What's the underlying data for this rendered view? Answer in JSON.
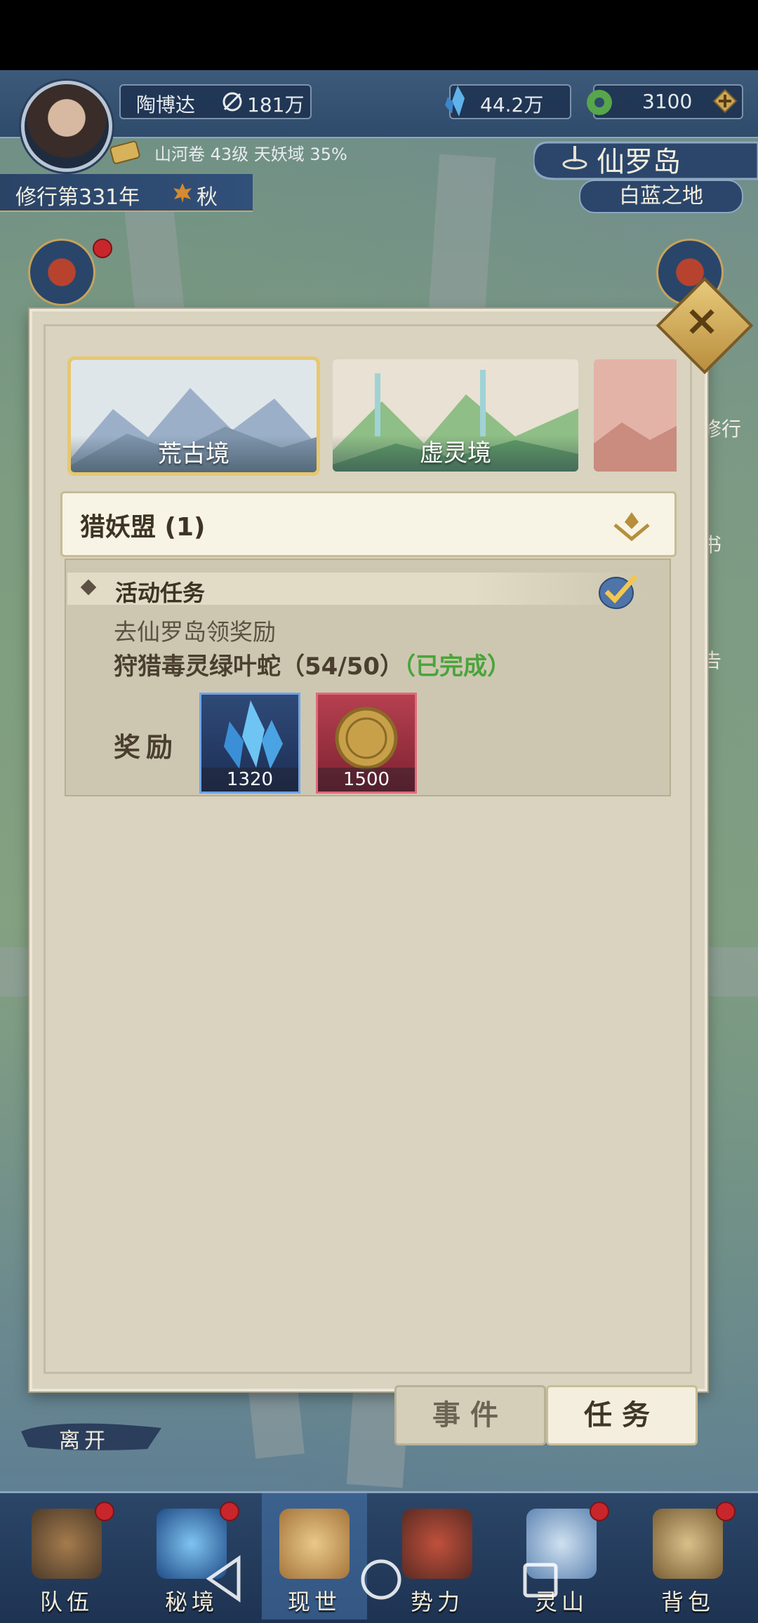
{
  "hud": {
    "player_name": "陶博达",
    "power": "181万",
    "crystal": "44.2万",
    "jade": "3100",
    "progress": "山河卷 43级 天妖域 35%",
    "year": "修行第331年",
    "season": "秋"
  },
  "location": {
    "name": "仙罗岛",
    "sub": "白蓝之地"
  },
  "side": {
    "right_1": "修行",
    "right_2": "书",
    "right_3": "告"
  },
  "tabs": [
    {
      "label": "荒古境"
    },
    {
      "label": "虚灵境"
    },
    {
      "label": ""
    }
  ],
  "dropdown": {
    "label": "猎妖盟 (1)"
  },
  "task": {
    "header": "活动任务",
    "desc": "去仙罗岛领奖励",
    "goal": "狩猎毒灵绿叶蛇（54/50）",
    "goal_status": "（已完成）",
    "reward_label": "奖励",
    "rewards": [
      {
        "icon": "crystal-icon",
        "qty": "1320"
      },
      {
        "icon": "coin-icon",
        "qty": "1500"
      }
    ]
  },
  "bottom_buttons": {
    "event": "事件",
    "task": "任务"
  },
  "leave": "离开",
  "nav": [
    "队伍",
    "秘境",
    "现世",
    "势力",
    "灵山",
    "背包"
  ],
  "colors": {
    "accent_gold": "#e7c76f",
    "complete_green": "#4aa43a",
    "panel_bg": "#d9d3bf"
  }
}
